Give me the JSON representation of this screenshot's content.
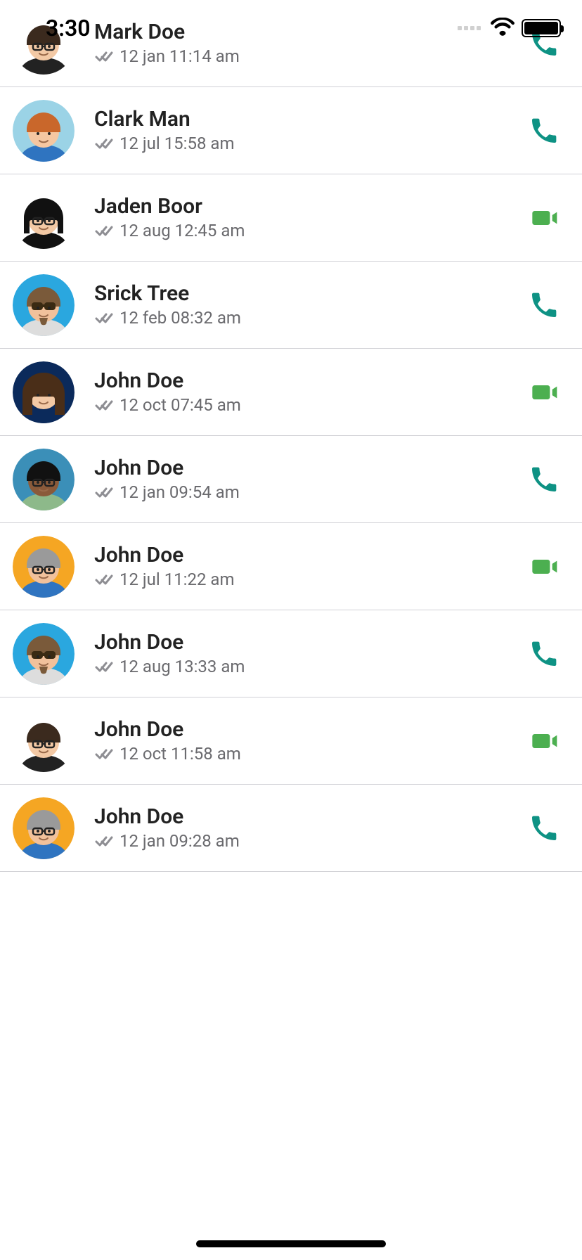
{
  "status_bar": {
    "time": "3:30"
  },
  "calls": [
    {
      "name": "Mark Doe",
      "time": "12 jan 11:14 am",
      "type": "audio",
      "avatar": "a1"
    },
    {
      "name": "Clark Man",
      "time": "12 jul 15:58 am",
      "type": "audio",
      "avatar": "a2"
    },
    {
      "name": "Jaden Boor",
      "time": "12 aug 12:45 am",
      "type": "video",
      "avatar": "a3"
    },
    {
      "name": "Srick Tree",
      "time": "12 feb 08:32 am",
      "type": "audio",
      "avatar": "a4"
    },
    {
      "name": "John Doe",
      "time": "12 oct 07:45 am",
      "type": "video",
      "avatar": "a5"
    },
    {
      "name": "John Doe",
      "time": "12 jan 09:54 am",
      "type": "audio",
      "avatar": "a6"
    },
    {
      "name": "John Doe",
      "time": "12 jul 11:22 am",
      "type": "video",
      "avatar": "a7"
    },
    {
      "name": "John Doe",
      "time": "12 aug 13:33 am",
      "type": "audio",
      "avatar": "a4"
    },
    {
      "name": "John Doe",
      "time": "12 oct 11:58 am",
      "type": "video",
      "avatar": "a1"
    },
    {
      "name": "John Doe",
      "time": "12 jan 09:28 am",
      "type": "audio",
      "avatar": "a7"
    }
  ],
  "colors": {
    "phone": "#0E9284",
    "video": "#4CAF50"
  }
}
